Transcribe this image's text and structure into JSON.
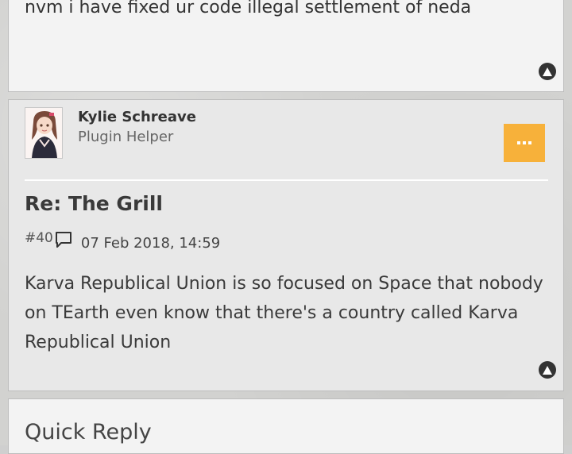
{
  "previous_post": {
    "body": "nvm i have fixed ur code illegal settlement of neda"
  },
  "post": {
    "author": {
      "name": "Kylie Schreave",
      "role": "Plugin Helper"
    },
    "title": "Re: The Grill",
    "number": "#40",
    "date": "07 Feb 2018, 14:59",
    "body": "Karva Republical Union is so focused on Space that nobody on TEarth even know that there's a country called Karva Republical Union"
  },
  "quick_reply": {
    "title": "Quick Reply"
  },
  "colors": {
    "accent": "#f7b13a",
    "card": "#e8e8e8",
    "text": "#3a3a3a"
  },
  "icons": {
    "scroll_top": "arrow-up-circle-icon",
    "more": "ellipsis-icon",
    "comment": "comment-icon"
  }
}
